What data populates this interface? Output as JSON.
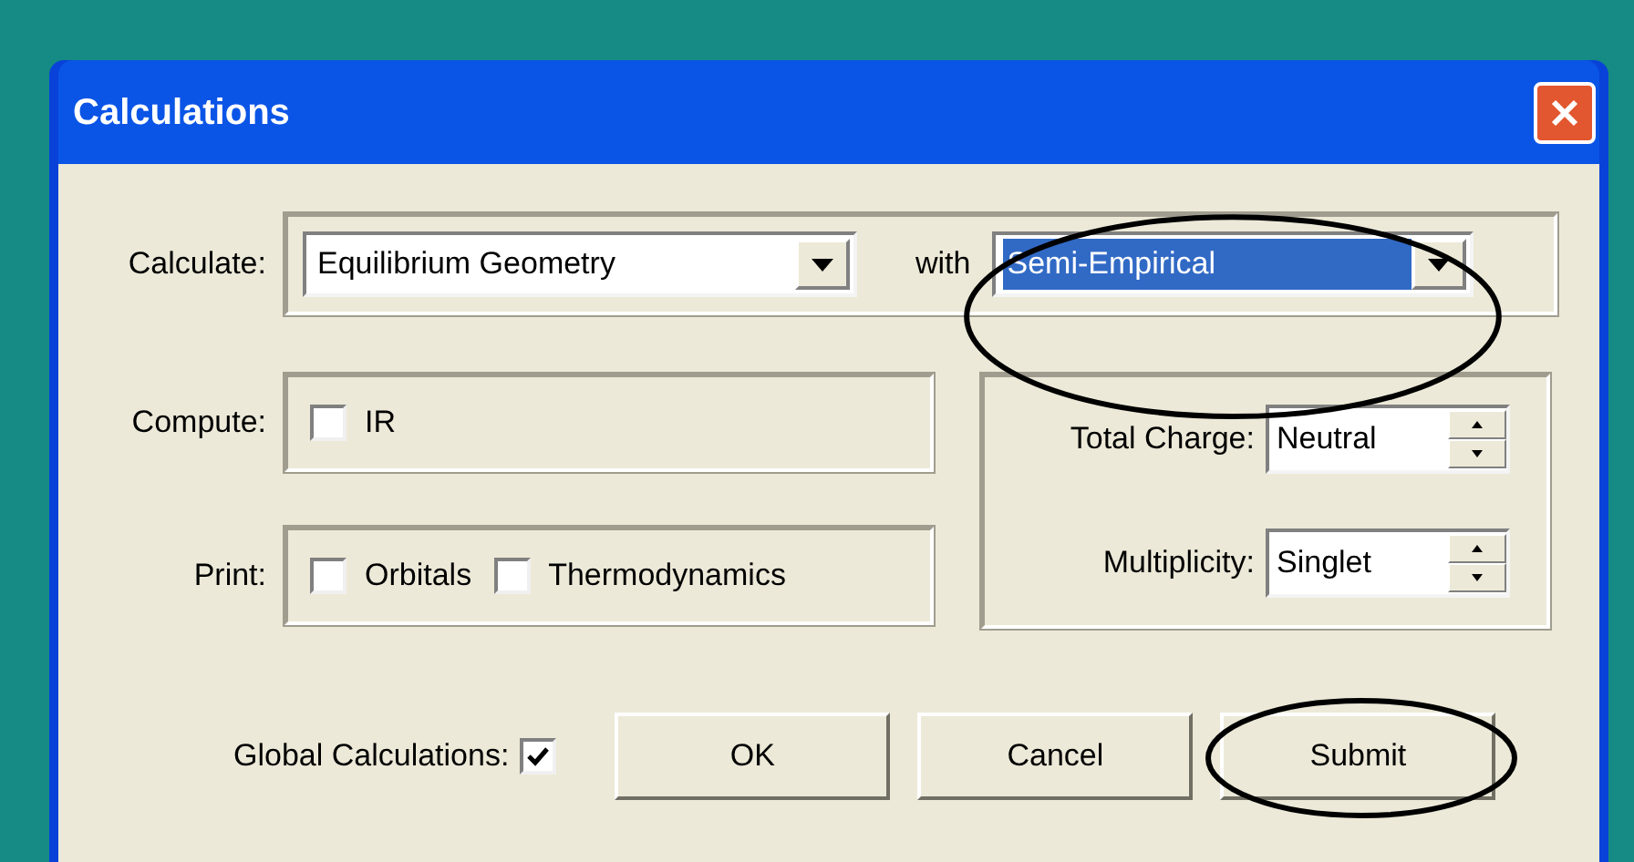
{
  "window": {
    "title": "Calculations"
  },
  "calculate": {
    "label": "Calculate:",
    "task": {
      "value": "Equilibrium Geometry",
      "highlighted": false,
      "circled": false
    },
    "with_label": "with",
    "method": {
      "value": "Semi-Empirical",
      "highlighted": true,
      "circled": true
    }
  },
  "compute": {
    "label": "Compute:",
    "options": [
      {
        "label": "IR",
        "checked": false
      }
    ]
  },
  "print": {
    "label": "Print:",
    "options": [
      {
        "label": "Orbitals",
        "checked": false
      },
      {
        "label": "Thermodynamics",
        "checked": false
      }
    ]
  },
  "spinners": [
    {
      "label": "Total Charge:",
      "value": "Neutral"
    },
    {
      "label": "Multiplicity:",
      "value": "Singlet"
    }
  ],
  "global": {
    "label": "Global Calculations:",
    "checked": true
  },
  "buttons": [
    {
      "label": "OK",
      "circled": false
    },
    {
      "label": "Cancel",
      "circled": false
    },
    {
      "label": "Submit",
      "circled": true
    }
  ]
}
